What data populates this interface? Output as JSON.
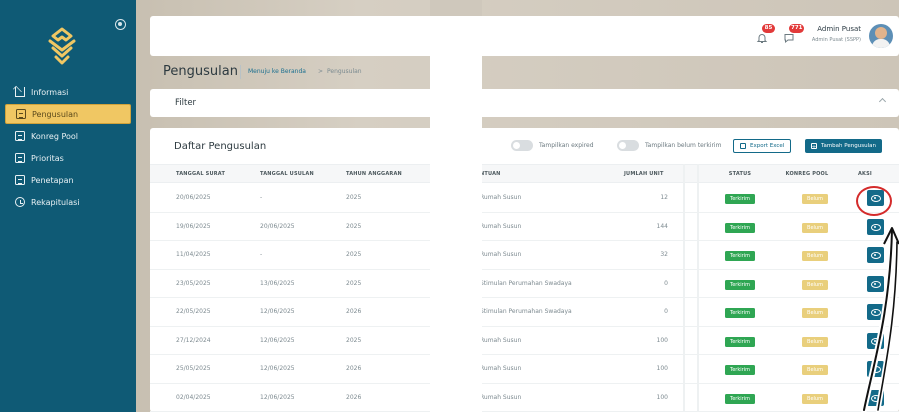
{
  "sidebar": {
    "items": [
      {
        "label": "Informasi",
        "icon": "home-icon",
        "active": false
      },
      {
        "label": "Pengusulan",
        "icon": "document-icon",
        "active": true
      },
      {
        "label": "Konreg Pool",
        "icon": "document-icon",
        "active": false
      },
      {
        "label": "Prioritas",
        "icon": "document-icon",
        "active": false
      },
      {
        "label": "Penetapan",
        "icon": "document-icon",
        "active": false
      },
      {
        "label": "Rekapitulasi",
        "icon": "clock-icon",
        "active": false
      }
    ]
  },
  "header": {
    "notifications": {
      "bell_count": "85",
      "chat_count": "771"
    },
    "user_name": "Admin Pusat",
    "user_role": "Admin Pusat (SSPP)"
  },
  "page": {
    "title": "Pengusulan",
    "breadcrumb_home": "Menuju ke Beranda",
    "breadcrumb_arrow": ">",
    "breadcrumb_current": "Pengusulan"
  },
  "filter": {
    "label": "Filter"
  },
  "table": {
    "title": "Daftar Pengusulan",
    "toggle_expired": "Tampilkan expired",
    "toggle_unsent": "Tampilkan belum terkirim",
    "export_label": "Export Excel",
    "add_label": "Tambah Pengusulan",
    "columns": [
      "TANGGAL SURAT",
      "TANGGAL USULAN",
      "TAHUN ANGGARAN",
      "NTUAN",
      "JUMLAH UNIT",
      "STATUS",
      "KONREG POOL",
      "AKSI"
    ],
    "rows": [
      {
        "tanggal_surat": "20/06/2025",
        "tanggal_usulan": "-",
        "tahun": "2025",
        "bantuan": "Rumah Susun",
        "unit": "12",
        "status": "Terkirim",
        "konreg": "Belum"
      },
      {
        "tanggal_surat": "19/06/2025",
        "tanggal_usulan": "20/06/2025",
        "tahun": "2025",
        "bantuan": "Rumah Susun",
        "unit": "144",
        "status": "Terkirim",
        "konreg": "Belum"
      },
      {
        "tanggal_surat": "11/04/2025",
        "tanggal_usulan": "-",
        "tahun": "2025",
        "bantuan": "Rumah Susun",
        "unit": "32",
        "status": "Terkirim",
        "konreg": "Belum"
      },
      {
        "tanggal_surat": "23/05/2025",
        "tanggal_usulan": "13/06/2025",
        "tahun": "2025",
        "bantuan": "Stimulan Perumahan Swadaya",
        "unit": "0",
        "status": "Terkirim",
        "konreg": "Belum"
      },
      {
        "tanggal_surat": "22/05/2025",
        "tanggal_usulan": "12/06/2025",
        "tahun": "2026",
        "bantuan": "Stimulan Perumahan Swadaya",
        "unit": "0",
        "status": "Terkirim",
        "konreg": "Belum"
      },
      {
        "tanggal_surat": "27/12/2024",
        "tanggal_usulan": "12/06/2025",
        "tahun": "2025",
        "bantuan": "Rumah Susun",
        "unit": "100",
        "status": "Terkirim",
        "konreg": "Belum"
      },
      {
        "tanggal_surat": "25/05/2025",
        "tanggal_usulan": "12/06/2025",
        "tahun": "2026",
        "bantuan": "Rumah Susun",
        "unit": "100",
        "status": "Terkirim",
        "konreg": "Belum"
      },
      {
        "tanggal_surat": "02/04/2025",
        "tanggal_usulan": "12/06/2025",
        "tahun": "2026",
        "bantuan": "Rumah Susun",
        "unit": "100",
        "status": "Terkirim",
        "konreg": "Belum"
      }
    ]
  },
  "colors": {
    "sidebar": "#0f5a75",
    "active": "#f0c763",
    "primary": "#136a89",
    "sent": "#2fa653",
    "pending": "#e9cf7c",
    "annotation": "#d42b2b"
  }
}
